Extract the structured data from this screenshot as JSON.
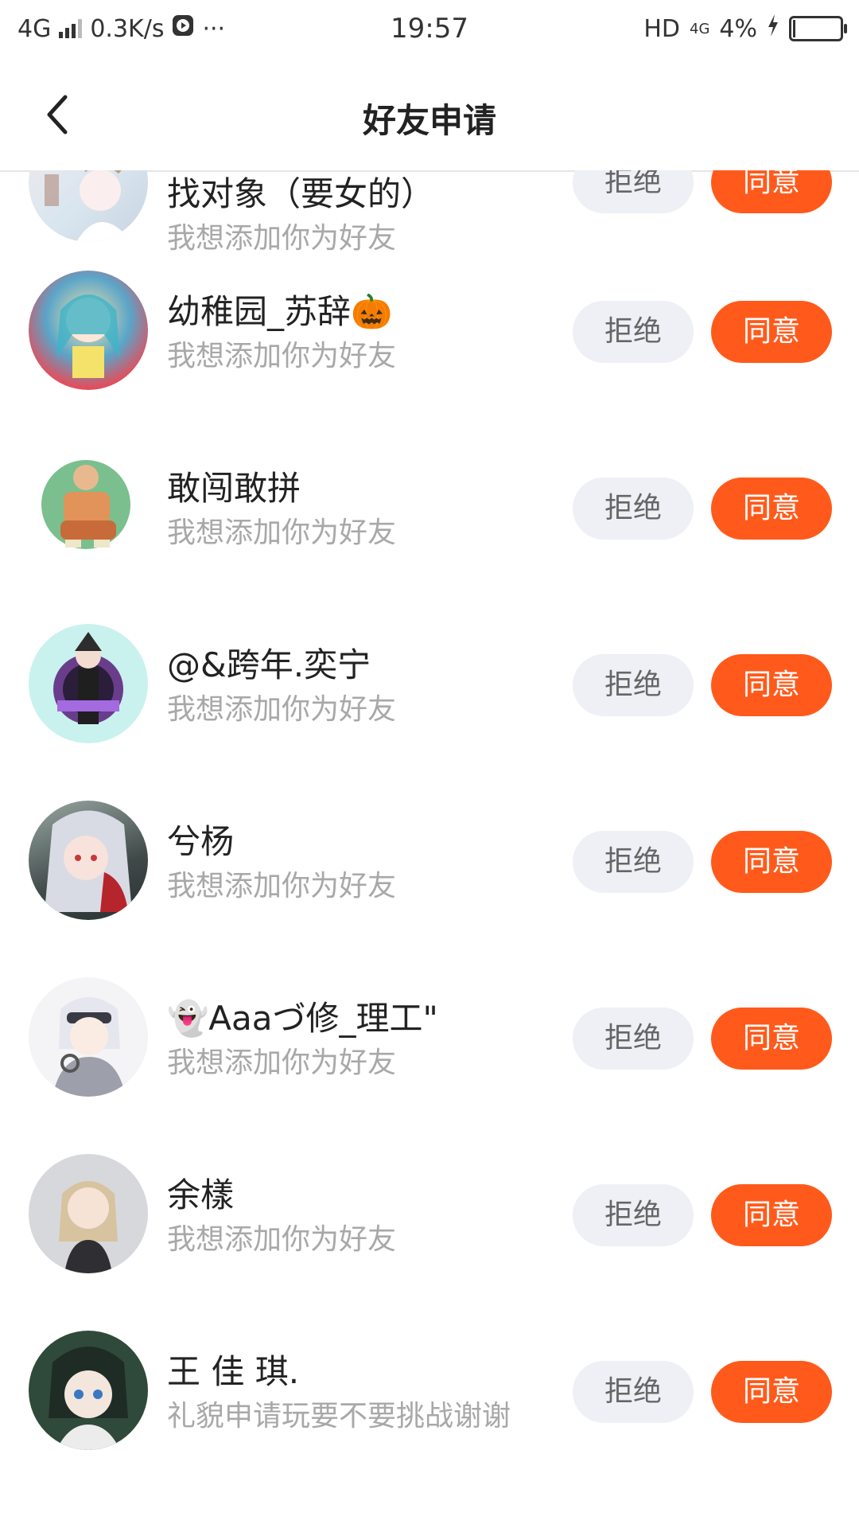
{
  "status_bar": {
    "network": "4G",
    "speed": "0.3K/s",
    "more": "···",
    "time": "19:57",
    "hd": "HD",
    "net_right": "4G",
    "battery": "4%"
  },
  "nav": {
    "title": "好友申请"
  },
  "requests": [
    {
      "name": "找对象（要女的）",
      "message": "我想添加你为好友",
      "reject": "拒绝",
      "agree": "同意"
    },
    {
      "name": "幼稚园_苏辞🎃",
      "message": "我想添加你为好友",
      "reject": "拒绝",
      "agree": "同意"
    },
    {
      "name": "敢闯敢拼",
      "message": "我想添加你为好友",
      "reject": "拒绝",
      "agree": "同意"
    },
    {
      "name": "@&跨年.奕宁",
      "message": "我想添加你为好友",
      "reject": "拒绝",
      "agree": "同意"
    },
    {
      "name": "兮杨",
      "message": "我想添加你为好友",
      "reject": "拒绝",
      "agree": "同意"
    },
    {
      "name": "👻Aaaづ修_理工\"",
      "message": "我想添加你为好友",
      "reject": "拒绝",
      "agree": "同意"
    },
    {
      "name": "余樣",
      "message": "我想添加你为好友",
      "reject": "拒绝",
      "agree": "同意"
    },
    {
      "name": "王 佳 琪.",
      "message": "礼貌申请玩要不要挑战谢谢",
      "reject": "拒绝",
      "agree": "同意"
    }
  ],
  "colors": {
    "agree": "#ff5a1b",
    "reject_bg": "#eef0f5",
    "subtext": "#a8a8a8"
  }
}
